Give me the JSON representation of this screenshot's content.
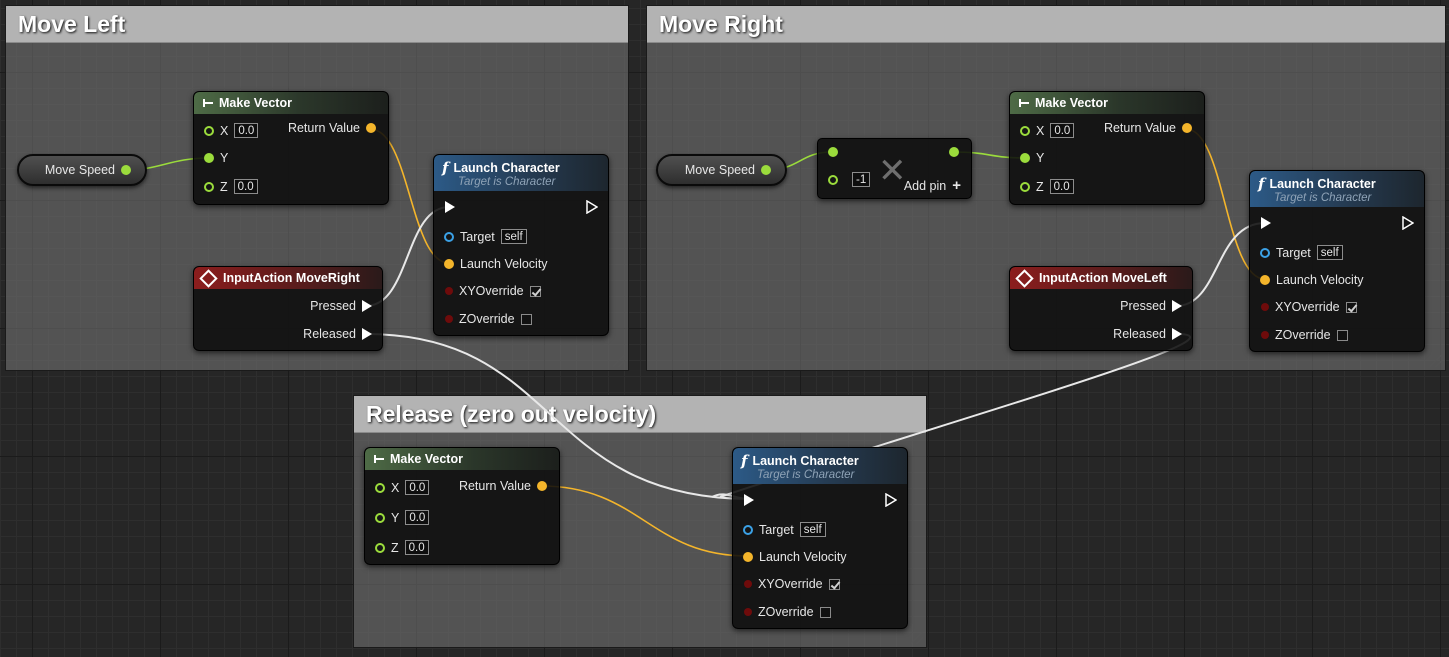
{
  "comments": {
    "move_left": "Move Left",
    "move_right": "Move Right",
    "release": "Release (zero out velocity)"
  },
  "move_left": {
    "move_speed": "Move Speed",
    "make_vector": {
      "title": "Make Vector",
      "x_label": "X",
      "x_value": "0.0",
      "y_label": "Y",
      "z_label": "Z",
      "z_value": "0.0",
      "return_label": "Return Value"
    },
    "input_action": {
      "title": "InputAction MoveRight",
      "pressed": "Pressed",
      "released": "Released"
    },
    "launch": {
      "title": "Launch Character",
      "subtitle": "Target is Character",
      "target_label": "Target",
      "target_value": "self",
      "velocity_label": "Launch Velocity",
      "xy_label": "XYOverride",
      "z_label": "ZOverride"
    }
  },
  "move_right": {
    "move_speed": "Move Speed",
    "multiply": {
      "value": "-1",
      "add_pin": "Add pin"
    },
    "make_vector": {
      "title": "Make Vector",
      "x_label": "X",
      "x_value": "0.0",
      "y_label": "Y",
      "z_label": "Z",
      "z_value": "0.0",
      "return_label": "Return Value"
    },
    "input_action": {
      "title": "InputAction MoveLeft",
      "pressed": "Pressed",
      "released": "Released"
    },
    "launch": {
      "title": "Launch Character",
      "subtitle": "Target is Character",
      "target_label": "Target",
      "target_value": "self",
      "velocity_label": "Launch Velocity",
      "xy_label": "XYOverride",
      "z_label": "ZOverride"
    }
  },
  "release": {
    "make_vector": {
      "title": "Make Vector",
      "x_label": "X",
      "x_value": "0.0",
      "y_label": "Y",
      "y_value": "0.0",
      "z_label": "Z",
      "z_value": "0.0",
      "return_label": "Return Value"
    },
    "launch": {
      "title": "Launch Character",
      "subtitle": "Target is Character",
      "target_label": "Target",
      "target_value": "self",
      "velocity_label": "Launch Velocity",
      "xy_label": "XYOverride",
      "z_label": "ZOverride"
    }
  },
  "checkbox_state": {
    "xy_override": true,
    "z_override": false
  },
  "colors": {
    "float_pin": "#9bdc3c",
    "vector_pin": "#f4b52b",
    "object_pin": "#3ba1e6",
    "bool_pin": "#6e0b0b",
    "exec_wire": "#e8e8e8"
  }
}
